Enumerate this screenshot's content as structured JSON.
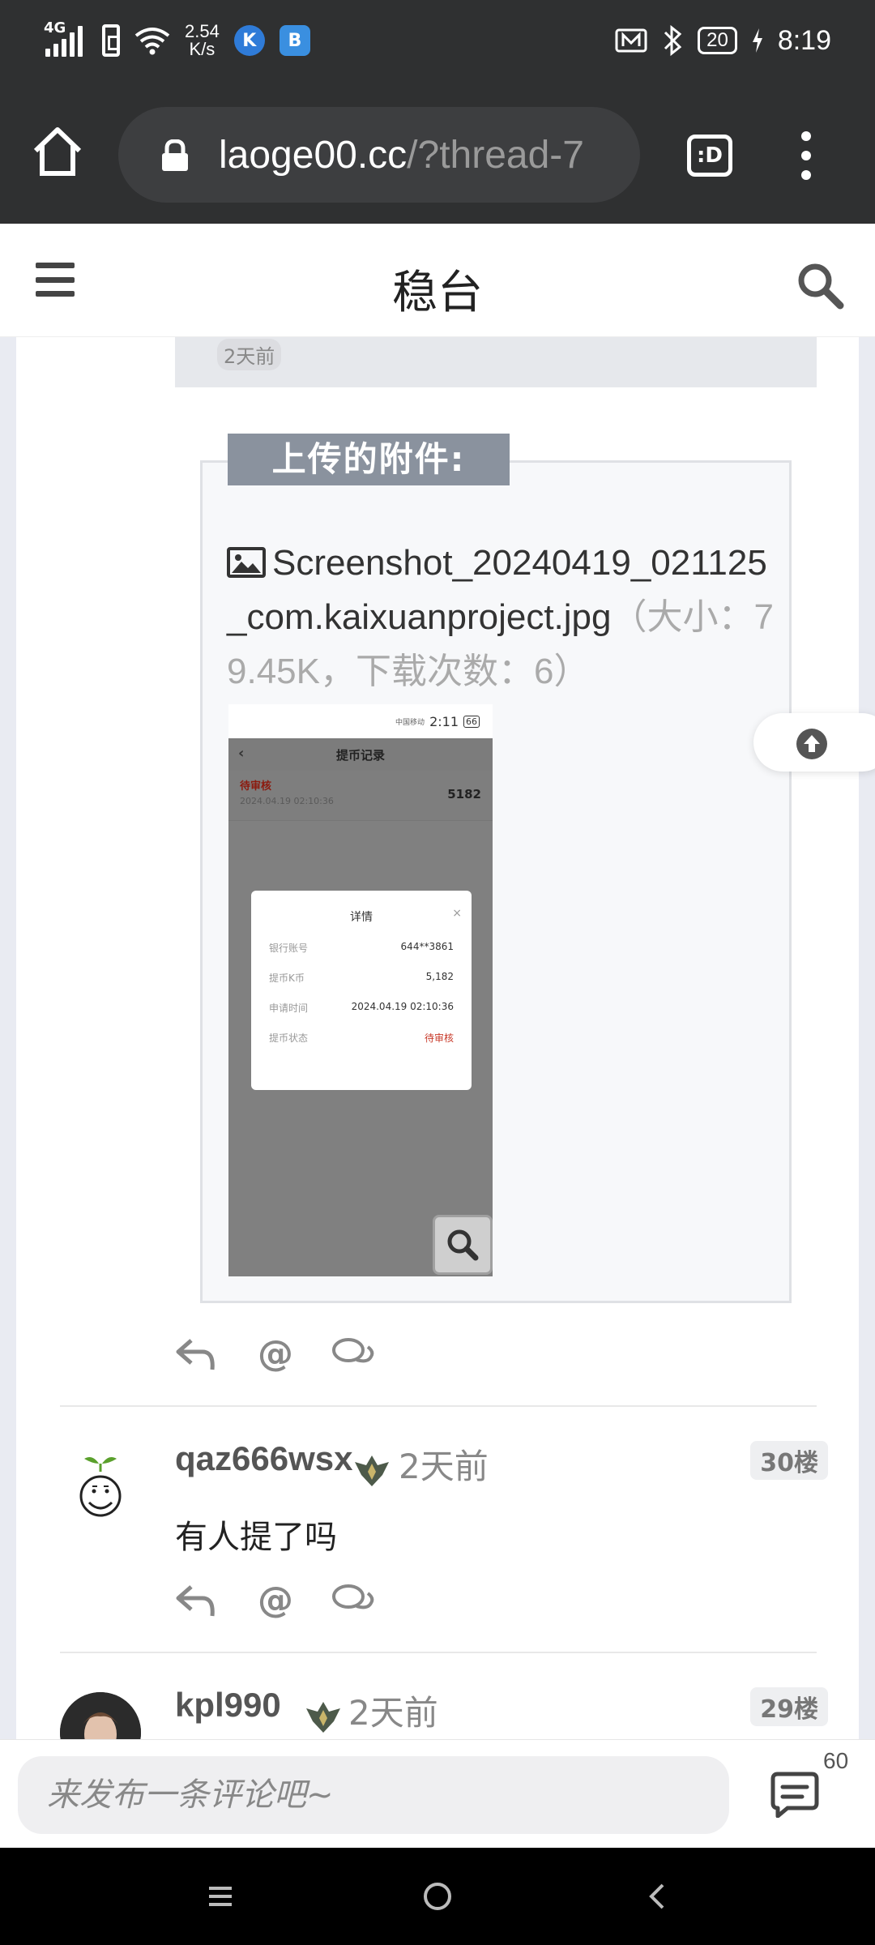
{
  "status_bar": {
    "network": "4G",
    "speed_value": "2.54",
    "speed_unit": "K/s",
    "app_badge_1": "K",
    "app_badge_2": "B",
    "battery": "20",
    "time": "8:19"
  },
  "browser": {
    "url_main": "laoge00.cc",
    "url_rest": "/?thread-7",
    "tabs_label": ":D"
  },
  "site": {
    "title": "稳台"
  },
  "quote": {
    "time": "2天前"
  },
  "attachment": {
    "section_title": "上传的附件:",
    "filename": "Screenshot_20240419_021125_com.kaixuanproject.jpg",
    "meta": "（大小：79.45K，下载次数：6）",
    "thumb": {
      "status_time": "2:11",
      "status_carrier": "中国移动",
      "battery": "66",
      "header": "提币记录",
      "back": "‹",
      "row_status": "待审核",
      "row_date": "2024.04.19 02:10:36",
      "row_amount": "5182",
      "modal_title": "详情",
      "modal_close": "×",
      "modal_rows": [
        {
          "label": "银行账号",
          "value": "644**3861"
        },
        {
          "label": "提币K币",
          "value": "5,182"
        },
        {
          "label": "申请时间",
          "value": "2024.04.19 02:10:36"
        },
        {
          "label": "提币状态",
          "value": "待审核"
        }
      ]
    }
  },
  "actions": {
    "at": "@"
  },
  "posts": [
    {
      "username": "qaz666wsx",
      "time": "2天前",
      "floor": "30楼",
      "body": "有人提了吗"
    },
    {
      "username": "kpl990",
      "time": "2天前",
      "floor": "29楼"
    }
  ],
  "comment_bar": {
    "placeholder": "来发布一条评论吧~",
    "count": "60"
  },
  "colors": {
    "bar_bg": "#2f3031",
    "accent_gray": "#8a929e",
    "pending_red": "#c83a2a"
  }
}
